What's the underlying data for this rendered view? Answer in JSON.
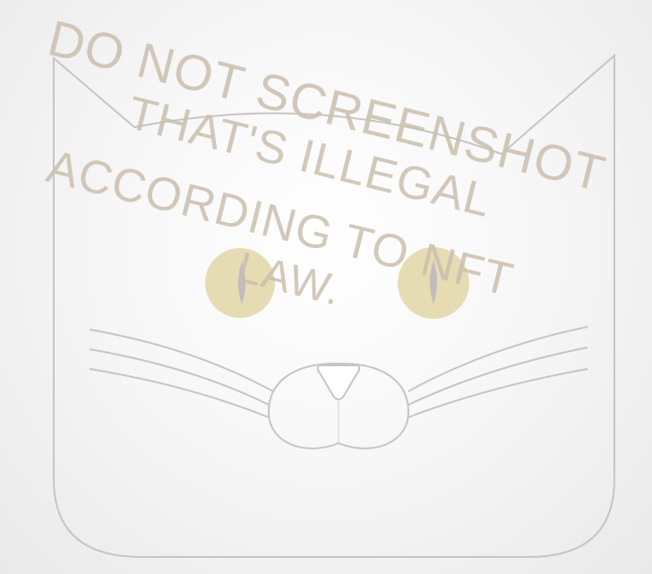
{
  "watermark": {
    "lines": [
      "DO NOT SCREENSHOT",
      "THAT'S ILLEGAL",
      "ACCORDING TO NFT",
      "LAW."
    ]
  },
  "colors": {
    "outline": "#c9c4c4",
    "eye_fill": "#e6dcb4",
    "pupil": "#c2bcbc",
    "watermark": "#cbbfae"
  }
}
